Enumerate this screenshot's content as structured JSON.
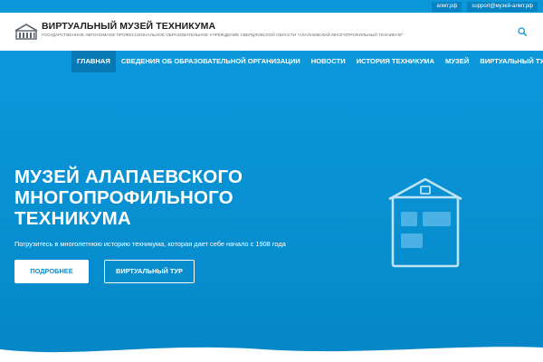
{
  "topbar": {
    "links": [
      "алмт.рф",
      "support@музей-алмт.рф"
    ]
  },
  "header": {
    "title": "ВИРТУАЛЬНЫЙ МУЗЕЙ ТЕХНИКУМА",
    "subtitle": "ГОСУДАРСТВЕННОЕ АВТОНОМНОЕ ПРОФЕССИОНАЛЬНОЕ ОБРАЗОВАТЕЛЬНОЕ УЧРЕЖДЕНИЕ СВЕРДЛОВСКОЙ ОБЛАСТИ \"АЛАПАЕВСКИЙ МНОГОПРОФИЛЬНЫЙ ТЕХНИКУМ\"",
    "logo_icon": "building-logo-icon",
    "search_icon": "search-icon"
  },
  "nav": {
    "items": [
      {
        "label": "ГЛАВНАЯ",
        "active": true
      },
      {
        "label": "СВЕДЕНИЯ ОБ ОБРАЗОВАТЕЛЬНОЙ ОРГАНИЗАЦИИ",
        "active": false
      },
      {
        "label": "НОВОСТИ",
        "active": false
      },
      {
        "label": "ИСТОРИЯ ТЕХНИКУМА",
        "active": false
      },
      {
        "label": "МУЗЕЙ",
        "active": false
      },
      {
        "label": "ВИРТУАЛЬНЫЙ ТУР",
        "active": false
      }
    ]
  },
  "hero": {
    "title_lines": [
      "МУЗЕЙ АЛАПАЕВСКОГО",
      "МНОГОПРОФИЛЬНОГО",
      "ТЕХНИКУМА"
    ],
    "text": "Погрузитесь в многолетнюю историю техникума, которая дает себе начало с 1908 года",
    "more_button": "ПОДРОБНЕЕ",
    "tour_button": "ВИРТУАЛЬНЫЙ ТУР",
    "illustration_icon": "house-icon"
  },
  "colors": {
    "primary": "#0a98da",
    "active_nav": "#0779b4",
    "background": "#ffffff",
    "title_text": "#1c1c1c"
  }
}
